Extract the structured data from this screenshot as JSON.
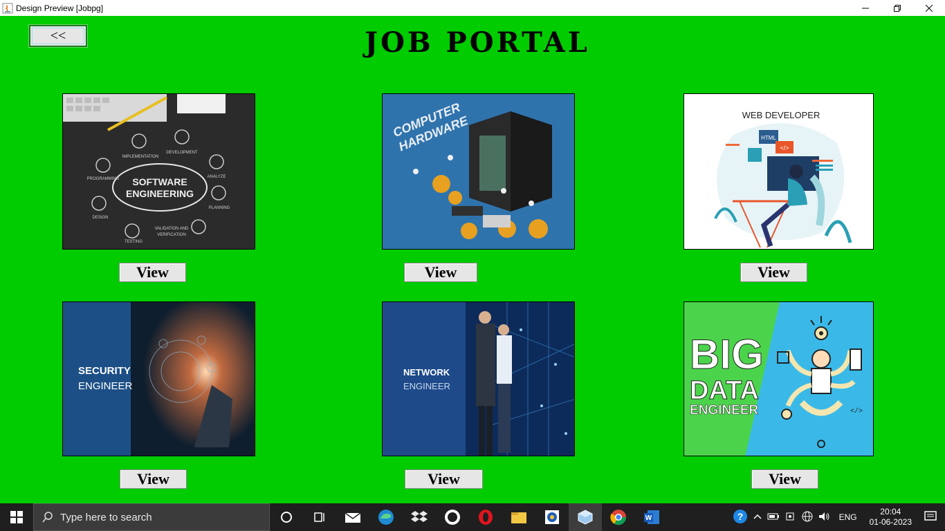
{
  "window": {
    "title": "Design Preview [Jobpg]",
    "controls": [
      "minimize",
      "restore",
      "close"
    ]
  },
  "header": {
    "back_label": "<<",
    "title": "JOB PORTAL"
  },
  "cards": [
    {
      "image": "software-engineering",
      "image_texts": [
        "SOFTWARE",
        "ENGINEERING",
        "IMPLEMENTATION",
        "DEVELOPMENT",
        "PROGRAMMING",
        "ANALYZE",
        "PLANNING",
        "DESIGN",
        "TESTING",
        "VALIDATION AND",
        "VERIFICATION"
      ],
      "button": "View"
    },
    {
      "image": "computer-hardware",
      "image_texts": [
        "COMPUTER",
        "HARDWARE"
      ],
      "button": "View"
    },
    {
      "image": "web-developer",
      "image_texts": [
        "WEB DEVELOPER",
        "HTML",
        "</>"
      ],
      "button": "View"
    },
    {
      "image": "security-engineer",
      "image_texts": [
        "SECURITY",
        "ENGINEER"
      ],
      "button": "View"
    },
    {
      "image": "network-engineer",
      "image_texts": [
        "NETWORK",
        "ENGINEER"
      ],
      "button": "View"
    },
    {
      "image": "big-data-engineer",
      "image_texts": [
        "BIG",
        "DATA",
        "ENGINEER",
        "</>"
      ],
      "button": "View"
    }
  ],
  "taskbar": {
    "search_placeholder": "Type here to search",
    "apps": [
      "cortana-icon",
      "task-view-icon",
      "mail-icon",
      "edge-icon",
      "dropbox-icon",
      "github-icon",
      "opera-icon",
      "file-explorer-icon",
      "photos-icon",
      "virtualbox-icon",
      "chrome-icon",
      "word-icon"
    ],
    "language": "ENG",
    "time": "20:04",
    "date": "01-06-2023"
  },
  "colors": {
    "background": "#00cc00",
    "button_bg": "#e6e6e6",
    "taskbar": "#1f1f1f"
  }
}
